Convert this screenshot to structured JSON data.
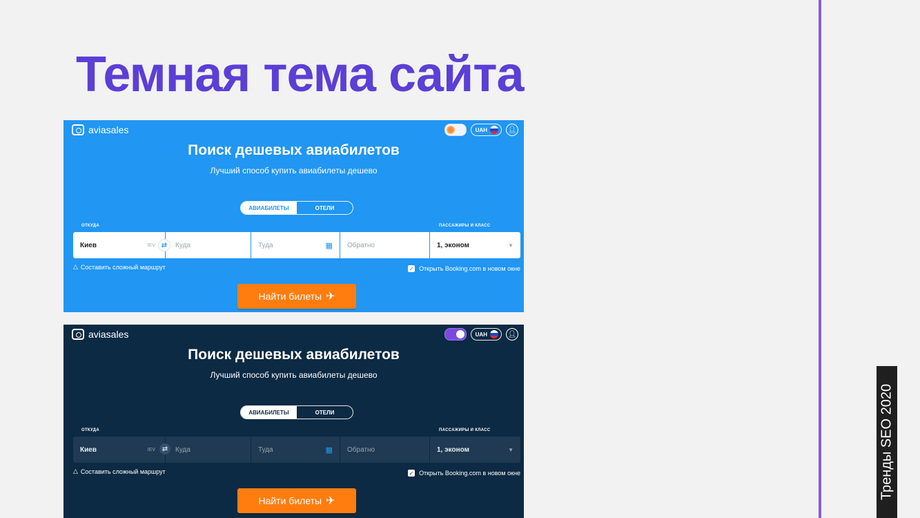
{
  "slide": {
    "title": "Темная тема сайта",
    "side_label": "Тренды SEO 2020"
  },
  "screens": {
    "light": {
      "logo_text": "aviasales",
      "currency": "UAH",
      "title": "Поиск дешевых авиабилетов",
      "subtitle": "Лучший способ купить авиабилеты дешево",
      "tab_flights": "АВИАБИЛЕТЫ",
      "tab_hotels": "ОТЕЛИ",
      "label_from": "ОТКУДА",
      "label_passengers": "ПАССАЖИРЫ И КЛАСС",
      "from_value": "Киев",
      "from_code": "IEV",
      "to_placeholder": "Куда",
      "depart_placeholder": "Туда",
      "return_placeholder": "Обратно",
      "passengers_value": "1, эконом",
      "complex_route": "Составить сложный маршрут",
      "booking_option": "Открыть Booking.com в новом окне",
      "search_button": "Найти билеты"
    },
    "dark": {
      "logo_text": "aviasales",
      "currency": "UAH",
      "title": "Поиск дешевых авиабилетов",
      "subtitle": "Лучший способ купить авиабилеты дешево",
      "tab_flights": "АВИАБИЛЕТЫ",
      "tab_hotels": "ОТЕЛИ",
      "label_from": "ОТКУДА",
      "label_passengers": "ПАССАЖИРЫ И КЛАСС",
      "from_value": "Киев",
      "from_code": "IEV",
      "to_placeholder": "Куда",
      "depart_placeholder": "Туда",
      "return_placeholder": "Обратно",
      "passengers_value": "1, эконом",
      "complex_route": "Составить сложный маршрут",
      "booking_option": "Открыть Booking.com в новом окне",
      "search_button": "Найти билеты"
    }
  },
  "colors": {
    "title": "#5b3fd6",
    "light_bg": "#2196f3",
    "dark_bg": "#0c2a43",
    "button": "#ff7d0f",
    "divider": "#8b5bd9"
  },
  "icons": [
    "logo-icon",
    "sun-toggle-icon",
    "moon-toggle-icon",
    "russia-flag-icon",
    "user-icon",
    "swap-icon",
    "calendar-icon",
    "chevron-down-icon",
    "route-icon",
    "checkbox-icon",
    "plane-icon"
  ]
}
